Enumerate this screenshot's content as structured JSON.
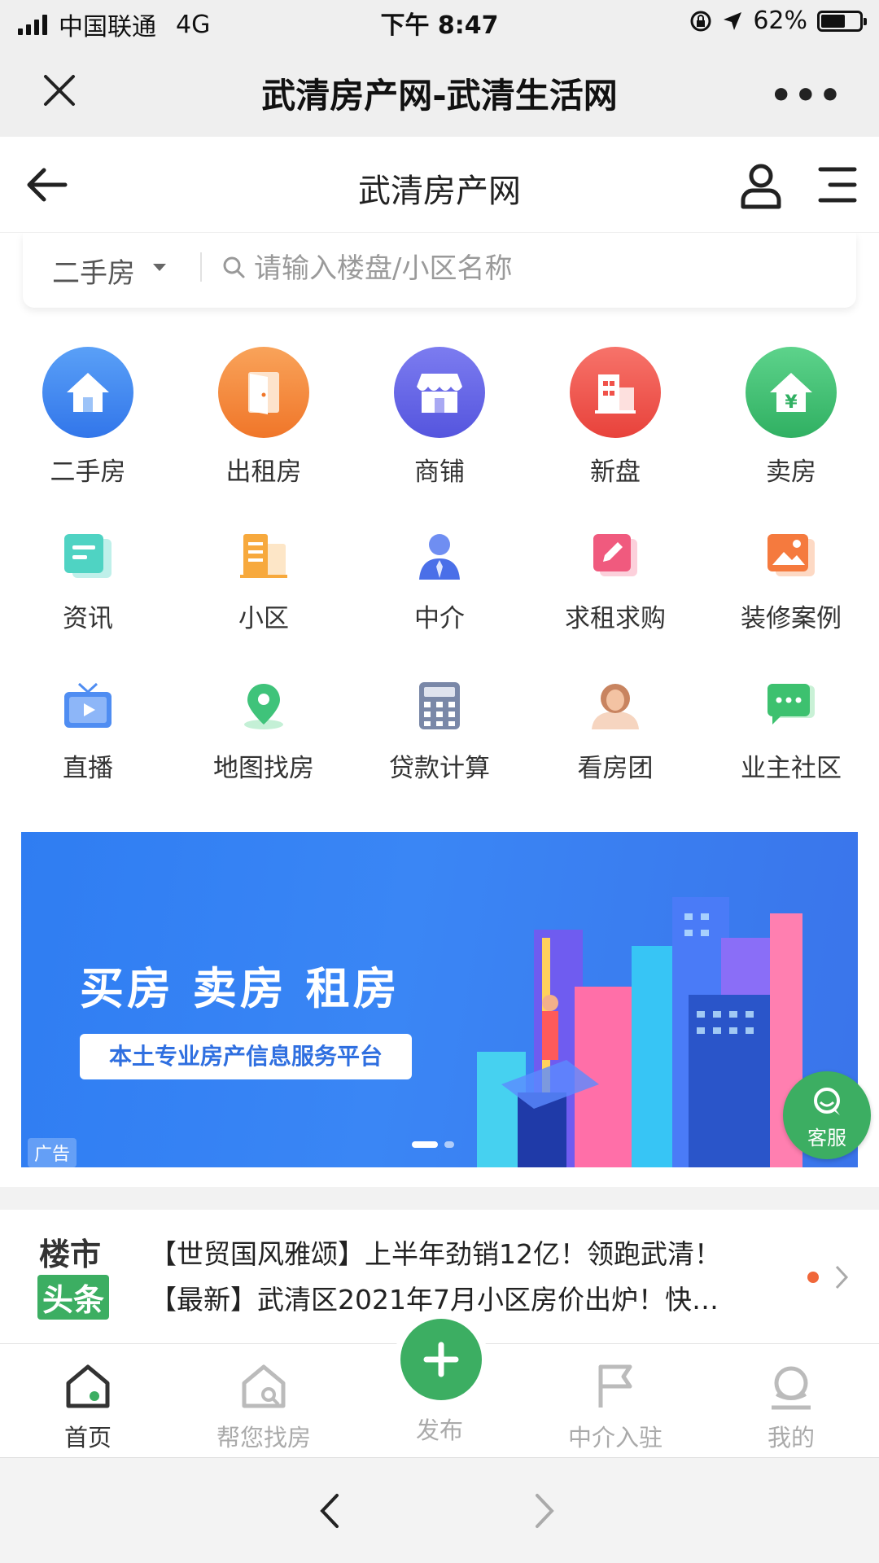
{
  "status_bar": {
    "carrier": "中国联通",
    "network": "4G",
    "time": "下午 8:47",
    "battery": "62%",
    "battery_level": 0.62
  },
  "wechat_bar": {
    "title": "武清房产网-武清生活网",
    "more": "•••"
  },
  "site_header": {
    "title": "武清房产网"
  },
  "search": {
    "type_label": "二手房",
    "placeholder": "请输入楼盘/小区名称"
  },
  "nav_grid": [
    [
      {
        "label": "二手房",
        "icon": "house-icon",
        "color": "#3f86f0"
      },
      {
        "label": "出租房",
        "icon": "door-icon",
        "color": "#f6883a"
      },
      {
        "label": "商铺",
        "icon": "shop-icon",
        "color": "#6767e6"
      },
      {
        "label": "新盘",
        "icon": "building-icon",
        "color": "#f0524a"
      },
      {
        "label": "卖房",
        "icon": "house-yen-icon",
        "color": "#3dbd6e"
      }
    ],
    [
      {
        "label": "资讯",
        "icon": "news-icon"
      },
      {
        "label": "小区",
        "icon": "community-icon"
      },
      {
        "label": "中介",
        "icon": "agent-icon"
      },
      {
        "label": "求租求购",
        "icon": "edit-icon"
      },
      {
        "label": "装修案例",
        "icon": "picture-icon"
      }
    ],
    [
      {
        "label": "直播",
        "icon": "tv-play-icon"
      },
      {
        "label": "地图找房",
        "icon": "map-pin-icon"
      },
      {
        "label": "贷款计算",
        "icon": "calculator-icon"
      },
      {
        "label": "看房团",
        "icon": "person-group-icon"
      },
      {
        "label": "业主社区",
        "icon": "chat-bubble-icon"
      }
    ]
  ],
  "banner": {
    "headline": "买房 卖房 租房",
    "subtitle": "本土专业房产信息服务平台",
    "ad_tag": "广告"
  },
  "customer_service": {
    "label": "客服"
  },
  "headlines": {
    "logo_top": "楼市",
    "logo_bottom": "头条",
    "items": [
      "【世贸国风雅颂】上半年劲销12亿！领跑武清！",
      "【最新】武清区2021年7月小区房价出炉！快…"
    ]
  },
  "tabbar": {
    "home": "首页",
    "find": "帮您找房",
    "publish": "发布",
    "agent": "中介入驻",
    "mine": "我的"
  },
  "colors": {
    "accent_green": "#3cae62",
    "banner_blue": "#3a86f5"
  }
}
